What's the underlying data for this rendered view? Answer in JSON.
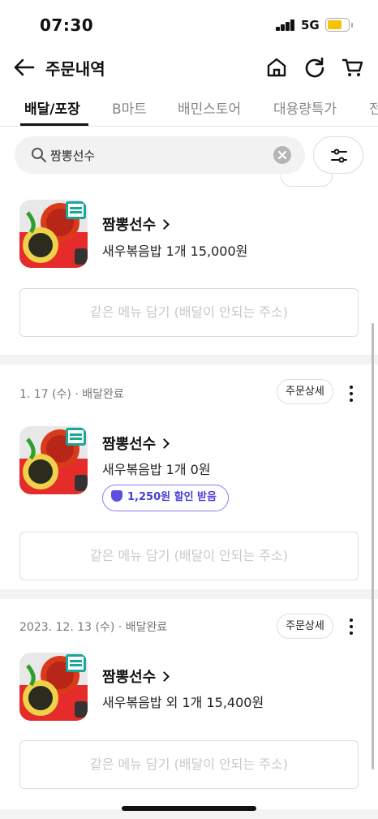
{
  "status_bar": {
    "time": "07:30",
    "network": "5G",
    "battery_color": "#f5c400"
  },
  "header": {
    "title": "주문내역",
    "icons": [
      "back-icon",
      "home-icon",
      "refresh-icon",
      "cart-icon"
    ]
  },
  "tabs": [
    {
      "label": "배달/포장",
      "active": true
    },
    {
      "label": "B마트",
      "active": false
    },
    {
      "label": "배민스토어",
      "active": false
    },
    {
      "label": "대용량특가",
      "active": false
    },
    {
      "label": "전",
      "active": false
    }
  ],
  "search": {
    "value": "짬뽕선수",
    "icons": [
      "search-icon",
      "clear-icon",
      "filter-icon"
    ]
  },
  "orders": [
    {
      "date": "",
      "status": "",
      "detail_label": "",
      "store": "짬뽕선수",
      "items": "새우볶음밥 1개 15,000원",
      "discount": "",
      "reorder_label": "같은 메뉴 담기 (배달이 안되는 주소)"
    },
    {
      "date": "1. 17 (수)",
      "status": "배달완료",
      "detail_label": "주문상세",
      "store": "짬뽕선수",
      "items": "새우볶음밥 1개 0원",
      "discount": "1,250원 할인 받음",
      "reorder_label": "같은 메뉴 담기 (배달이 안되는 주소)"
    },
    {
      "date": "2023. 12. 13 (수)",
      "status": "배달완료",
      "detail_label": "주문상세",
      "store": "짬뽕선수",
      "items": "새우볶음밥 외 1개 15,400원",
      "discount": "",
      "reorder_label": "같은 메뉴 담기 (배달이 안되는 주소)"
    }
  ],
  "colors": {
    "accent": "#111111",
    "discount": "#4a3fd6",
    "disabled_text": "#c9c9c9"
  }
}
